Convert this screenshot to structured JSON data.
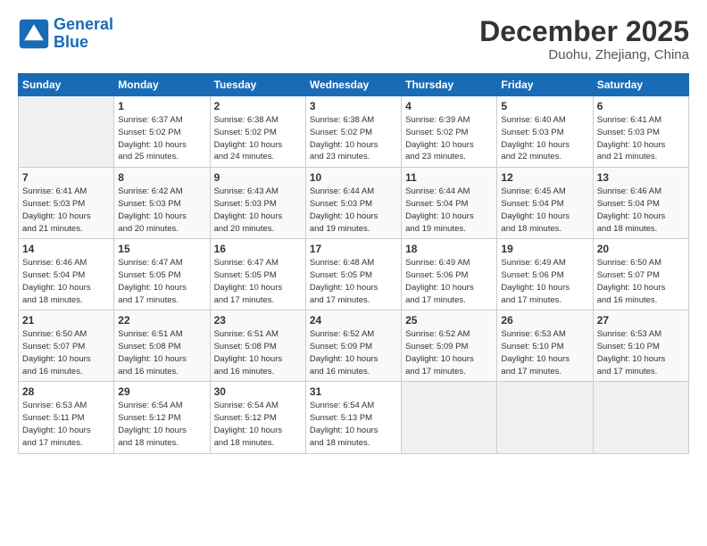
{
  "logo": {
    "line1": "General",
    "line2": "Blue"
  },
  "title": "December 2025",
  "subtitle": "Duohu, Zhejiang, China",
  "headers": [
    "Sunday",
    "Monday",
    "Tuesday",
    "Wednesday",
    "Thursday",
    "Friday",
    "Saturday"
  ],
  "weeks": [
    [
      {
        "day": "",
        "info": ""
      },
      {
        "day": "1",
        "info": "Sunrise: 6:37 AM\nSunset: 5:02 PM\nDaylight: 10 hours\nand 25 minutes."
      },
      {
        "day": "2",
        "info": "Sunrise: 6:38 AM\nSunset: 5:02 PM\nDaylight: 10 hours\nand 24 minutes."
      },
      {
        "day": "3",
        "info": "Sunrise: 6:38 AM\nSunset: 5:02 PM\nDaylight: 10 hours\nand 23 minutes."
      },
      {
        "day": "4",
        "info": "Sunrise: 6:39 AM\nSunset: 5:02 PM\nDaylight: 10 hours\nand 23 minutes."
      },
      {
        "day": "5",
        "info": "Sunrise: 6:40 AM\nSunset: 5:03 PM\nDaylight: 10 hours\nand 22 minutes."
      },
      {
        "day": "6",
        "info": "Sunrise: 6:41 AM\nSunset: 5:03 PM\nDaylight: 10 hours\nand 21 minutes."
      }
    ],
    [
      {
        "day": "7",
        "info": "Sunrise: 6:41 AM\nSunset: 5:03 PM\nDaylight: 10 hours\nand 21 minutes."
      },
      {
        "day": "8",
        "info": "Sunrise: 6:42 AM\nSunset: 5:03 PM\nDaylight: 10 hours\nand 20 minutes."
      },
      {
        "day": "9",
        "info": "Sunrise: 6:43 AM\nSunset: 5:03 PM\nDaylight: 10 hours\nand 20 minutes."
      },
      {
        "day": "10",
        "info": "Sunrise: 6:44 AM\nSunset: 5:03 PM\nDaylight: 10 hours\nand 19 minutes."
      },
      {
        "day": "11",
        "info": "Sunrise: 6:44 AM\nSunset: 5:04 PM\nDaylight: 10 hours\nand 19 minutes."
      },
      {
        "day": "12",
        "info": "Sunrise: 6:45 AM\nSunset: 5:04 PM\nDaylight: 10 hours\nand 18 minutes."
      },
      {
        "day": "13",
        "info": "Sunrise: 6:46 AM\nSunset: 5:04 PM\nDaylight: 10 hours\nand 18 minutes."
      }
    ],
    [
      {
        "day": "14",
        "info": "Sunrise: 6:46 AM\nSunset: 5:04 PM\nDaylight: 10 hours\nand 18 minutes."
      },
      {
        "day": "15",
        "info": "Sunrise: 6:47 AM\nSunset: 5:05 PM\nDaylight: 10 hours\nand 17 minutes."
      },
      {
        "day": "16",
        "info": "Sunrise: 6:47 AM\nSunset: 5:05 PM\nDaylight: 10 hours\nand 17 minutes."
      },
      {
        "day": "17",
        "info": "Sunrise: 6:48 AM\nSunset: 5:05 PM\nDaylight: 10 hours\nand 17 minutes."
      },
      {
        "day": "18",
        "info": "Sunrise: 6:49 AM\nSunset: 5:06 PM\nDaylight: 10 hours\nand 17 minutes."
      },
      {
        "day": "19",
        "info": "Sunrise: 6:49 AM\nSunset: 5:06 PM\nDaylight: 10 hours\nand 17 minutes."
      },
      {
        "day": "20",
        "info": "Sunrise: 6:50 AM\nSunset: 5:07 PM\nDaylight: 10 hours\nand 16 minutes."
      }
    ],
    [
      {
        "day": "21",
        "info": "Sunrise: 6:50 AM\nSunset: 5:07 PM\nDaylight: 10 hours\nand 16 minutes."
      },
      {
        "day": "22",
        "info": "Sunrise: 6:51 AM\nSunset: 5:08 PM\nDaylight: 10 hours\nand 16 minutes."
      },
      {
        "day": "23",
        "info": "Sunrise: 6:51 AM\nSunset: 5:08 PM\nDaylight: 10 hours\nand 16 minutes."
      },
      {
        "day": "24",
        "info": "Sunrise: 6:52 AM\nSunset: 5:09 PM\nDaylight: 10 hours\nand 16 minutes."
      },
      {
        "day": "25",
        "info": "Sunrise: 6:52 AM\nSunset: 5:09 PM\nDaylight: 10 hours\nand 17 minutes."
      },
      {
        "day": "26",
        "info": "Sunrise: 6:53 AM\nSunset: 5:10 PM\nDaylight: 10 hours\nand 17 minutes."
      },
      {
        "day": "27",
        "info": "Sunrise: 6:53 AM\nSunset: 5:10 PM\nDaylight: 10 hours\nand 17 minutes."
      }
    ],
    [
      {
        "day": "28",
        "info": "Sunrise: 6:53 AM\nSunset: 5:11 PM\nDaylight: 10 hours\nand 17 minutes."
      },
      {
        "day": "29",
        "info": "Sunrise: 6:54 AM\nSunset: 5:12 PM\nDaylight: 10 hours\nand 18 minutes."
      },
      {
        "day": "30",
        "info": "Sunrise: 6:54 AM\nSunset: 5:12 PM\nDaylight: 10 hours\nand 18 minutes."
      },
      {
        "day": "31",
        "info": "Sunrise: 6:54 AM\nSunset: 5:13 PM\nDaylight: 10 hours\nand 18 minutes."
      },
      {
        "day": "",
        "info": ""
      },
      {
        "day": "",
        "info": ""
      },
      {
        "day": "",
        "info": ""
      }
    ]
  ]
}
